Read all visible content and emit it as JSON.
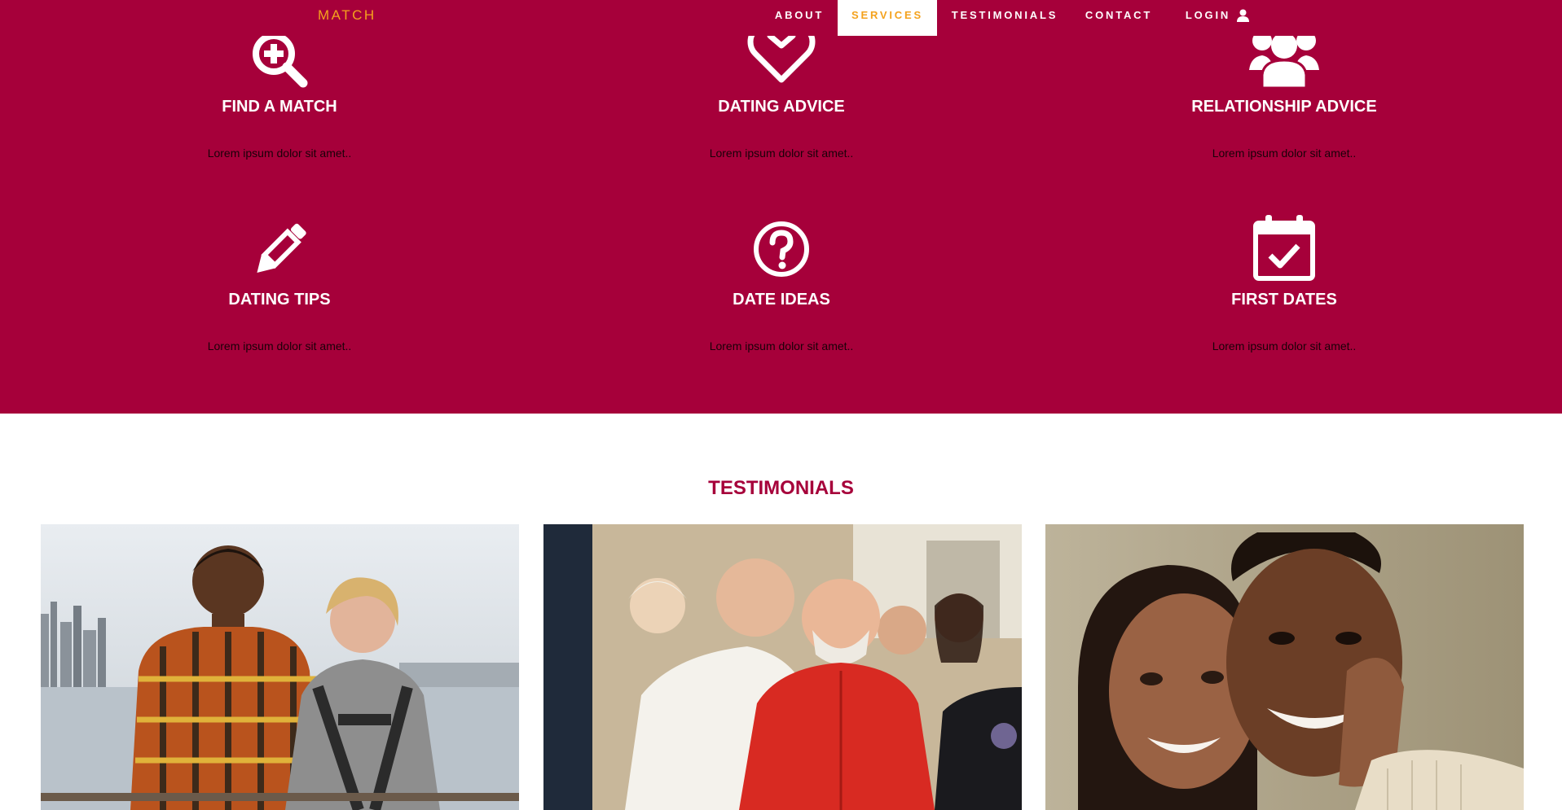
{
  "brand": "MATCH",
  "nav": {
    "about": "ABOUT",
    "services": "SERVICES",
    "testimonials": "TESTIMONIALS",
    "contact": "CONTACT",
    "login": "LOGIN",
    "active": "SERVICES"
  },
  "services": [
    {
      "title": "FIND A MATCH",
      "desc": "Lorem ipsum dolor sit amet..",
      "icon": "magnify-plus-icon"
    },
    {
      "title": "DATING ADVICE",
      "desc": "Lorem ipsum dolor sit amet..",
      "icon": "heart-icon"
    },
    {
      "title": "RELATIONSHIP ADVICE",
      "desc": "Lorem ipsum dolor sit amet..",
      "icon": "group-icon"
    },
    {
      "title": "DATING TIPS",
      "desc": "Lorem ipsum dolor sit amet..",
      "icon": "pencil-icon"
    },
    {
      "title": "DATE IDEAS",
      "desc": "Lorem ipsum dolor sit amet..",
      "icon": "question-circle-icon"
    },
    {
      "title": "FIRST DATES",
      "desc": "Lorem ipsum dolor sit amet..",
      "icon": "calendar-check-icon"
    }
  ],
  "testimonials": {
    "title": "TESTIMONIALS"
  },
  "colors": {
    "primary": "#a6003a",
    "accent": "#f4a21d",
    "text_light": "#ffffff"
  }
}
